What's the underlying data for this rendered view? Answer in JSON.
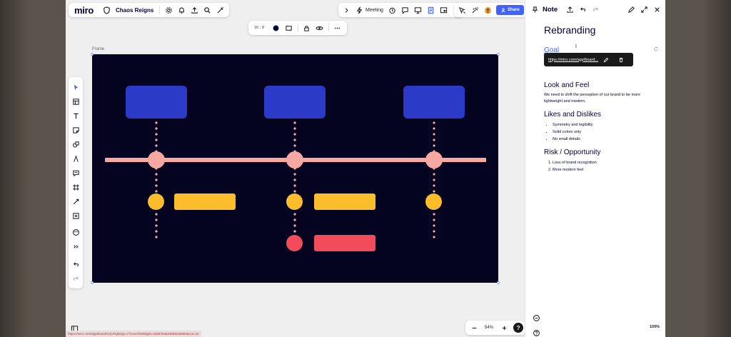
{
  "toolbar": {
    "logo": "miro",
    "board_name": "Chaos Reigns",
    "meeting_label": "Meeting",
    "share_label": "Share"
  },
  "frame_toolbar": {
    "ratio": "16 : 9"
  },
  "frame": {
    "label": "Frame"
  },
  "zoom": {
    "value": "54%"
  },
  "url_hint": "https://miro.com/app/board/uXjVPgkOgn=/?moveToWidget=3458764533689345953&cot=10",
  "note": {
    "panel_title": "Note",
    "title": "Rebranding",
    "goal_link": "Goal",
    "link_url": "https://miro.com/app/board...",
    "sections": {
      "look": {
        "heading": "Look and Feel",
        "body": "We need to shift the perception of our brand to be more lightweight and modern."
      },
      "likes": {
        "heading": "Likes and Dislikes",
        "items": [
          "Symmetry and legibility",
          "Solid colors only",
          "No small details"
        ]
      },
      "risk": {
        "heading": "Risk / Opportunity",
        "items": [
          "Loss of brand recognition",
          "More modern feel"
        ]
      }
    },
    "zoom_pct": "100%"
  },
  "colors": {
    "accent": "#4262ff",
    "frame_bg": "#040420",
    "box_blue": "#2b3bc7",
    "timeline_pink": "#f8a8a2",
    "yellow": "#fbbd2c",
    "red": "#f24b5a"
  }
}
